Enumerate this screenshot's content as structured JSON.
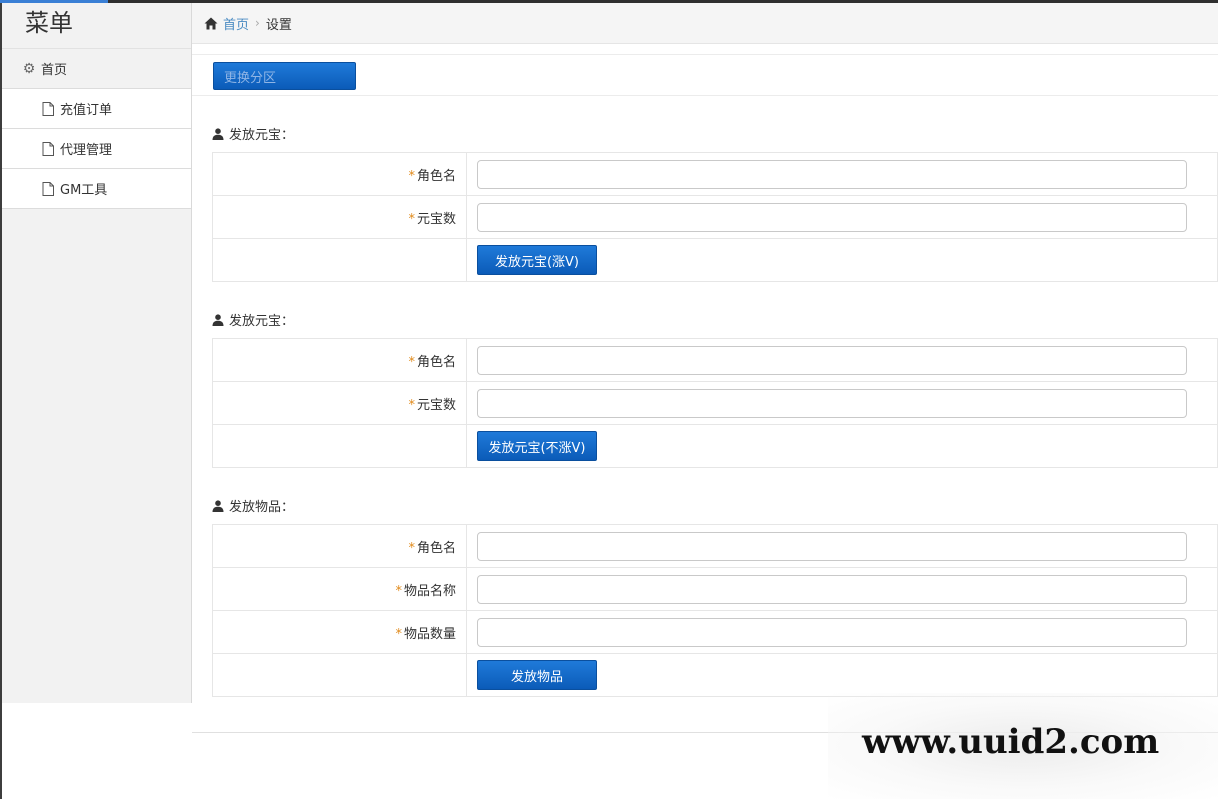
{
  "sidebar": {
    "title": "菜单",
    "home_label": "首页",
    "items": [
      {
        "label": "充值订单"
      },
      {
        "label": "代理管理"
      },
      {
        "label": "GM工具"
      }
    ]
  },
  "breadcrumb": {
    "home": "首页",
    "current": "设置"
  },
  "toolbar": {
    "switch_label": "更换分区"
  },
  "sections": [
    {
      "title": "发放元宝：",
      "fields": [
        {
          "label": "角色名",
          "required": true,
          "value": ""
        },
        {
          "label": "元宝数",
          "required": true,
          "value": ""
        }
      ],
      "submit_label": "发放元宝(涨V)"
    },
    {
      "title": "发放元宝：",
      "fields": [
        {
          "label": "角色名",
          "required": true,
          "value": ""
        },
        {
          "label": "元宝数",
          "required": true,
          "value": ""
        }
      ],
      "submit_label": "发放元宝(不涨V)"
    },
    {
      "title": "发放物品：",
      "fields": [
        {
          "label": "角色名",
          "required": true,
          "value": ""
        },
        {
          "label": "物品名称",
          "required": true,
          "value": ""
        },
        {
          "label": "物品数量",
          "required": true,
          "value": ""
        }
      ],
      "submit_label": "发放物品"
    }
  ],
  "required_marker": "*",
  "watermark": "www.uuid2.com",
  "colors": {
    "accent_blue": "#1f7ad9",
    "link_blue": "#4a8bc2",
    "required_orange": "#e08a1a"
  }
}
